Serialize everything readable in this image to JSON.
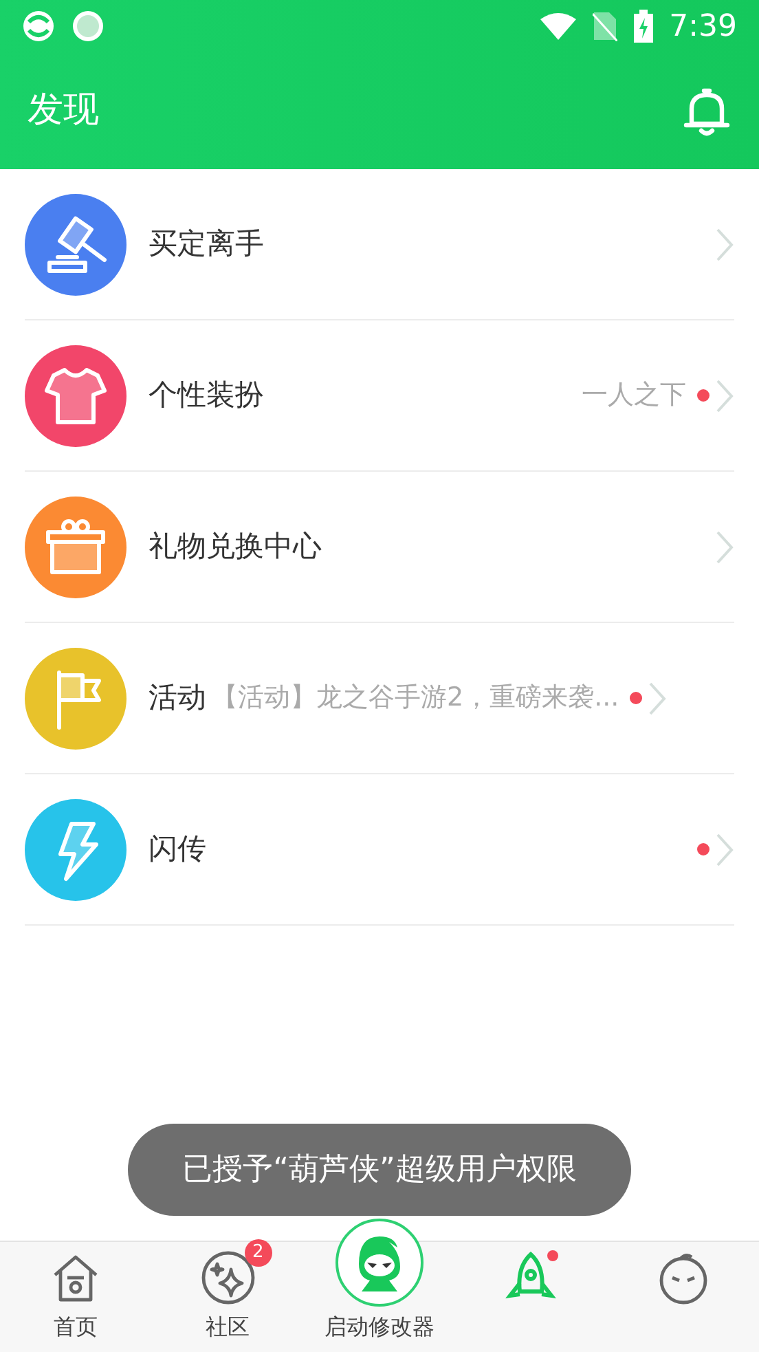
{
  "status_bar": {
    "time": "7:39"
  },
  "app_bar": {
    "title": "发现"
  },
  "items": [
    {
      "kind": "gavel",
      "color": "#4a7ff0",
      "title": "买定离手",
      "dot": false
    },
    {
      "kind": "shirt",
      "color": "#f2466a",
      "title": "个性装扮",
      "subtitle": "一人之下",
      "dot": true
    },
    {
      "kind": "gift",
      "color": "#fb8a33",
      "title": "礼物兑换中心",
      "dot": false
    },
    {
      "kind": "flag",
      "color": "#e8c22b",
      "title": "活动",
      "subtitle": "【活动】龙之谷手游2，重磅来袭...",
      "dot": true
    },
    {
      "kind": "bolt",
      "color": "#27c3ea",
      "title": "闪传",
      "dot": true
    }
  ],
  "toast": "已授予“葫芦侠”超级用户权限",
  "bottom_nav": [
    {
      "kind": "home",
      "label": "首页"
    },
    {
      "kind": "stars",
      "label": "社区",
      "badge": "2"
    },
    {
      "kind": "launcher",
      "label": "启动修改器"
    },
    {
      "kind": "rocket",
      "dot": true
    },
    {
      "kind": "face"
    }
  ]
}
